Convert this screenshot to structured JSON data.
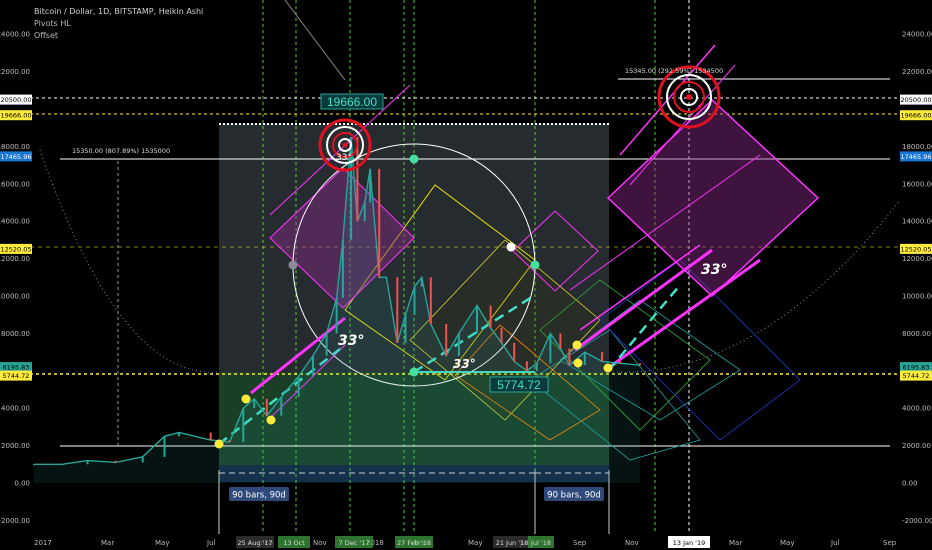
{
  "header": {
    "title": "Bitcoin / Dollar, 1D, BITSTAMP, Heikin Ashi",
    "indicator_1": "Pivots HL",
    "indicator_2": "Offset"
  },
  "colors": {
    "background": "#000000",
    "price_line": "#26a69a",
    "down_candle": "#ef5350",
    "channel": "#ff33ff",
    "dash_trend": "#44e0c8",
    "yellow_marker": "#ffeb3b",
    "cyan_label": "#00bcd4",
    "red_target": "#e01020",
    "green_vline": "#55cc33"
  },
  "chart_data": {
    "type": "line",
    "title": "Bitcoin / Dollar, 1D, BITSTAMP, Heikin Ashi",
    "x_tick_labels": [
      "2017",
      "Mar",
      "May",
      "Jul",
      "Sep",
      "Nov",
      "2018",
      "Mar",
      "May",
      "Jul",
      "Sep",
      "Nov",
      "Mar",
      "May",
      "Jul",
      "Sep"
    ],
    "x_highlight_labels": [
      "25 Aug '17",
      "13 Oct",
      "7 Dec '17",
      "27 Feb '18",
      "21 Jun '18",
      "Jul '18",
      "13 Jan '19"
    ],
    "y_tick_labels": [
      "24000.00",
      "22000.00",
      "18000.00",
      "16000.00",
      "14000.00",
      "12000.00",
      "10000.00",
      "8000.00",
      "6000.00",
      "4000.00",
      "2000.00",
      "0.00",
      "-2000.00"
    ],
    "ylim": [
      -2000,
      25000
    ],
    "price_markers": [
      {
        "value": "20500.00",
        "style": "white"
      },
      {
        "value": "19666.00",
        "style": "yellow"
      },
      {
        "value": "17465.96",
        "style": "blue"
      },
      {
        "value": "12520.05",
        "style": "yellow"
      },
      {
        "value": "6195.83",
        "style": "green"
      },
      {
        "value": "5744.72",
        "style": "yellow"
      }
    ],
    "series": [
      {
        "x": [
          "2017-01-01",
          "2017-02-01",
          "2017-03-01",
          "2017-04-01",
          "2017-05-01",
          "2017-05-25",
          "2017-06-10",
          "2017-07-15",
          "2017-08-05",
          "2017-08-20",
          "2017-09-01",
          "2017-09-15",
          "2017-10-01",
          "2017-10-20",
          "2017-11-05",
          "2017-11-20",
          "2017-12-01",
          "2017-12-08",
          "2017-12-17",
          "2017-12-24",
          "2018-01-01",
          "2018-01-07",
          "2018-01-17",
          "2018-01-25",
          "2018-02-06",
          "2018-02-15",
          "2018-02-25",
          "2018-03-05",
          "2018-03-15",
          "2018-04-01",
          "2018-04-15",
          "2018-05-05",
          "2018-05-20",
          "2018-06-01",
          "2018-06-15",
          "2018-06-29",
          "2018-07-10",
          "2018-07-25",
          "2018-08-05",
          "2018-08-15",
          "2018-09-01",
          "2018-09-20",
          "2018-10-10",
          "2018-11-01"
        ],
        "values": [
          1000,
          1000,
          1200,
          1100,
          1400,
          2500,
          2700,
          2300,
          2200,
          4000,
          4500,
          3600,
          4600,
          5700,
          6800,
          8000,
          9900,
          13000,
          18500,
          14000,
          15000,
          16800,
          11000,
          11000,
          7500,
          9000,
          10500,
          11000,
          8500,
          6800,
          8000,
          9500,
          8300,
          7500,
          6500,
          6000,
          6400,
          8000,
          7200,
          6300,
          7000,
          6500,
          6400,
          6300
        ]
      }
    ],
    "annotations": [
      {
        "text": "19666.00",
        "kind": "label"
      },
      {
        "text": "5774.72",
        "kind": "label"
      },
      {
        "text": "33°",
        "kind": "angle"
      },
      {
        "text": "33°",
        "kind": "angle"
      },
      {
        "text": "33°",
        "kind": "angle"
      },
      {
        "text": "33°",
        "kind": "angle"
      },
      {
        "text": "15350.00 (807.89%) 1535000",
        "kind": "measure"
      },
      {
        "text": "15345.00 (292.59%) 1534500",
        "kind": "measure"
      },
      {
        "text": "90 bars, 90d",
        "kind": "range"
      },
      {
        "text": "90 bars, 90d",
        "kind": "range"
      }
    ],
    "grid": false
  }
}
